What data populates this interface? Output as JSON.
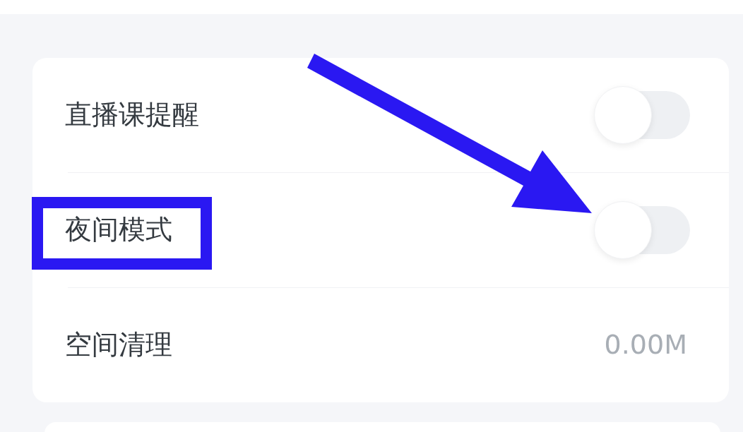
{
  "rows": [
    {
      "kind": "toggle",
      "label": "直播课提醒",
      "on": false,
      "highlighted": false
    },
    {
      "kind": "toggle",
      "label": "夜间模式",
      "on": false,
      "highlighted": true
    },
    {
      "kind": "value",
      "label": "空间清理",
      "value": "0.00M",
      "highlighted": false
    }
  ],
  "annotations": [
    {
      "kind": "arrow"
    }
  ]
}
